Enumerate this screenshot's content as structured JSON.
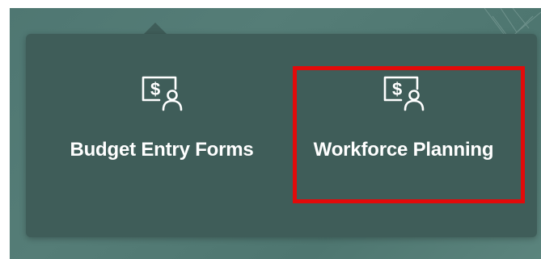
{
  "navigator": {
    "tiles": [
      {
        "label": "Budget Entry Forms",
        "icon": "budget-person-icon"
      },
      {
        "label": "Workforce Planning",
        "icon": "budget-person-icon"
      }
    ],
    "highlighted_tile": "Workforce Planning"
  },
  "colors": {
    "background": "#557d77",
    "popover": "#3f5d59",
    "text": "#ffffff",
    "highlight": "#e30a0a"
  }
}
